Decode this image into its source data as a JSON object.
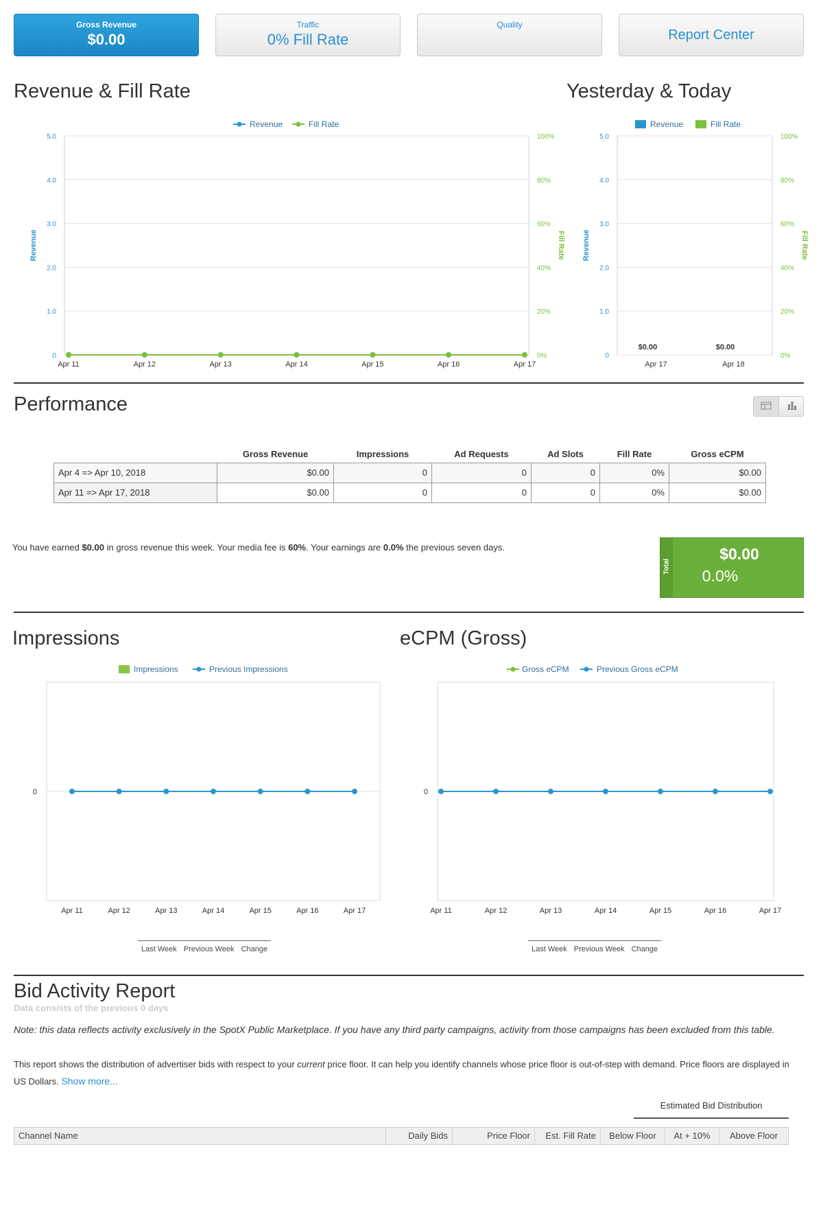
{
  "tiles": [
    {
      "label": "Gross Revenue",
      "value": "$0.00",
      "active": true
    },
    {
      "label": "Traffic",
      "value": "0% Fill Rate",
      "active": false
    },
    {
      "label": "Quality",
      "value": "",
      "active": false
    },
    {
      "label": "",
      "value": "Report Center",
      "active": false
    }
  ],
  "sections": {
    "revenue_fill": "Revenue & Fill Rate",
    "yesterday_today": "Yesterday & Today",
    "performance": "Performance",
    "impressions": "Impressions",
    "ecpm": "eCPM (Gross)",
    "bid_activity": "Bid Activity Report"
  },
  "colors": {
    "revenue": "#2a96cf",
    "fill_rate": "#7cc13a",
    "impressions_bar": "#8cc44a",
    "prev": "#2a96cf",
    "total_box": "#6aaf3a"
  },
  "performance": {
    "headers": [
      "",
      "Gross Revenue",
      "Impressions",
      "Ad Requests",
      "Ad Slots",
      "Fill Rate",
      "Gross eCPM"
    ],
    "rows": [
      [
        "Apr 4 => Apr 10, 2018",
        "$0.00",
        "0",
        "0",
        "0",
        "0%",
        "$0.00"
      ],
      [
        "Apr 11 => Apr 17, 2018",
        "$0.00",
        "0",
        "0",
        "0",
        "0%",
        "$0.00"
      ]
    ],
    "toggle": [
      "table-icon",
      "bar-chart-icon"
    ]
  },
  "summary": {
    "p1": "You have earned ",
    "earned": "$0.00",
    "p2": " in gross revenue this week. Your media fee is ",
    "fee": "60%",
    "p3": ". Your earnings are ",
    "earnings": "0.0%",
    "p4": " the previous seven days."
  },
  "total_box": {
    "label": "Total",
    "amount": "$0.00",
    "percent": "0.0%"
  },
  "segments": [
    "Last Week",
    "Previous Week",
    "Change"
  ],
  "bid": {
    "subtitle": "Data consists of the previous 0 days",
    "note": "Note: this data reflects activity exclusively in the SpotX Public Marketplace. If you have any third party campaigns, activity from those campaigns has been excluded from this table.",
    "desc1": "This report shows the distribution of advertiser bids with respect to your ",
    "desc_em": "current",
    "desc2": " price floor. It can help you identify channels whose price floor is out-of-step with demand. Price floors are displayed in US Dollars. ",
    "show_more": "Show more...",
    "est_header": "Estimated Bid Distribution",
    "columns": [
      "Channel Name",
      "Daily Bids",
      "Price Floor",
      "Est. Fill Rate",
      "Below Floor",
      "At + 10%",
      "Above Floor"
    ]
  },
  "chart_data": [
    {
      "type": "line",
      "categories": [
        "Apr 11",
        "Apr 12",
        "Apr 13",
        "Apr 14",
        "Apr 15",
        "Apr 16",
        "Apr 17"
      ],
      "series": [
        {
          "name": "Revenue",
          "values": [
            0,
            0,
            0,
            0,
            0,
            0,
            0
          ],
          "axis": "left"
        },
        {
          "name": "Fill Rate",
          "values": [
            0,
            0,
            0,
            0,
            0,
            0,
            0
          ],
          "axis": "right"
        }
      ],
      "ylabel": "Revenue",
      "ylabel_right": "Fill Rate",
      "ylim": [
        0,
        5
      ],
      "ylim_right": [
        0,
        100
      ],
      "yticks": [
        "0",
        "1.0",
        "2.0",
        "3.0",
        "4.0",
        "5.0"
      ],
      "yticks_right": [
        "0%",
        "20%",
        "40%",
        "60%",
        "80%",
        "100%"
      ],
      "legend": "top-center",
      "grid": true
    },
    {
      "type": "bar",
      "categories": [
        "Apr 17",
        "Apr 18"
      ],
      "series": [
        {
          "name": "Revenue",
          "values": [
            0,
            0
          ]
        },
        {
          "name": "Fill Rate",
          "values": [
            0,
            0
          ]
        }
      ],
      "data_labels": [
        "$0.00",
        "$0.00"
      ],
      "ylabel": "Revenue",
      "ylabel_right": "Fill Rate",
      "ylim": [
        0,
        5
      ],
      "ylim_right": [
        0,
        100
      ],
      "yticks": [
        "0",
        "1.0",
        "2.0",
        "3.0",
        "4.0",
        "5.0"
      ],
      "yticks_right": [
        "0%",
        "20%",
        "40%",
        "60%",
        "80%",
        "100%"
      ],
      "legend": "top-center",
      "grid": true
    },
    {
      "type": "line",
      "categories": [
        "Apr 11",
        "Apr 12",
        "Apr 13",
        "Apr 14",
        "Apr 15",
        "Apr 16",
        "Apr 17"
      ],
      "series": [
        {
          "name": "Impressions",
          "values": [
            0,
            0,
            0,
            0,
            0,
            0,
            0
          ]
        },
        {
          "name": "Previous Impressions",
          "values": [
            0,
            0,
            0,
            0,
            0,
            0,
            0
          ]
        }
      ],
      "yticks": [
        "0"
      ],
      "legend": "top-center",
      "grid": true
    },
    {
      "type": "line",
      "categories": [
        "Apr 11",
        "Apr 12",
        "Apr 13",
        "Apr 14",
        "Apr 15",
        "Apr 16",
        "Apr 17"
      ],
      "series": [
        {
          "name": "Gross eCPM",
          "values": [
            0,
            0,
            0,
            0,
            0,
            0,
            0
          ]
        },
        {
          "name": "Previous Gross eCPM",
          "values": [
            0,
            0,
            0,
            0,
            0,
            0,
            0
          ]
        }
      ],
      "yticks": [
        "0"
      ],
      "legend": "top-center",
      "grid": true
    }
  ]
}
